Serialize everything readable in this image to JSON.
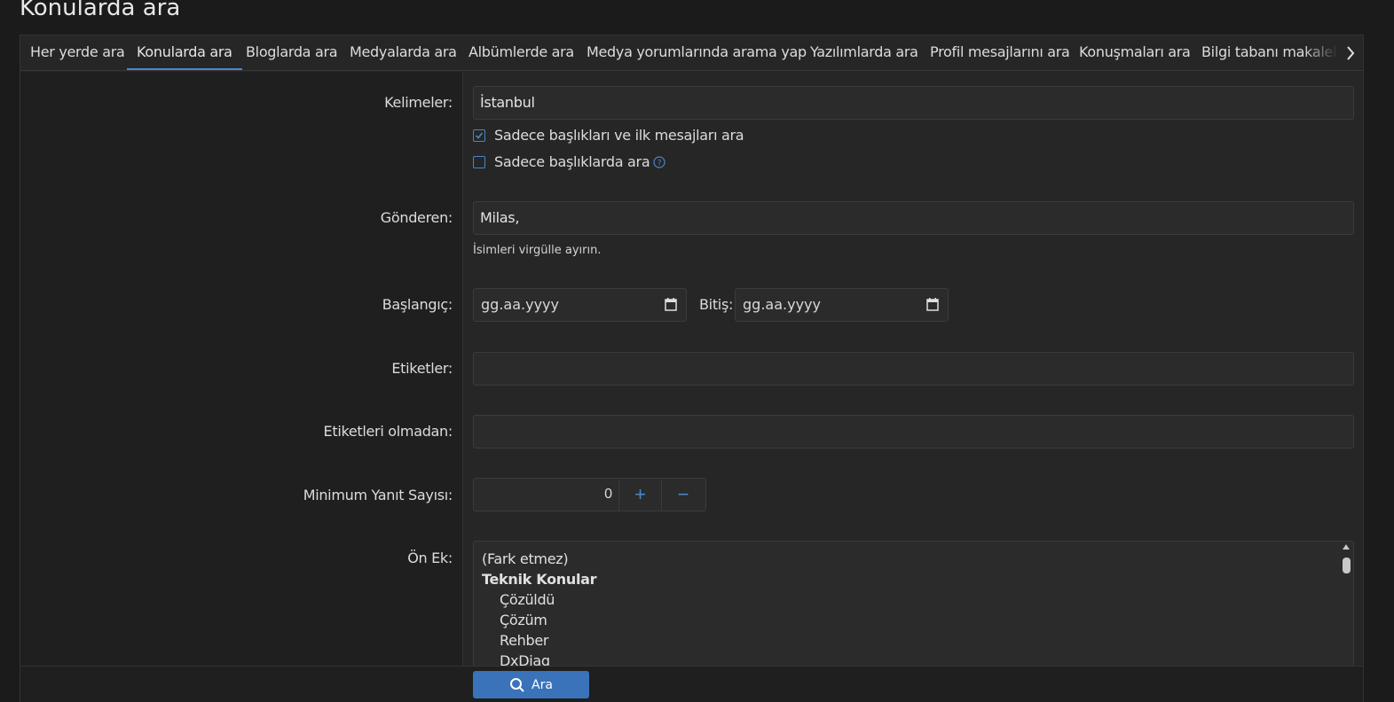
{
  "page": {
    "title": "Konularda ara"
  },
  "tabs": [
    {
      "label": "Her yerde ara"
    },
    {
      "label": "Konularda ara"
    },
    {
      "label": "Bloglarda ara"
    },
    {
      "label": "Medyalarda ara"
    },
    {
      "label": "Albümlerde ara"
    },
    {
      "label": "Medya yorumlarında arama yap"
    },
    {
      "label": "Yazılımlarda ara"
    },
    {
      "label": "Profil mesajlarını ara"
    },
    {
      "label": "Konuşmaları ara"
    },
    {
      "label": "Bilgi tabanı makaleleri"
    }
  ],
  "form": {
    "keywords": {
      "label": "Kelimeler:",
      "value": "İstanbul"
    },
    "title_first_checkbox": {
      "label": "Sadece başlıkları ve ilk mesajları ara",
      "checked": true
    },
    "title_only_checkbox": {
      "label": "Sadece başlıklarda ara",
      "checked": false
    },
    "posted_by": {
      "label": "Gönderen:",
      "value": "Milas,",
      "hint": "İsimleri virgülle ayırın."
    },
    "start_date": {
      "label": "Başlangıç:",
      "placeholder": "gg.aa.yyyy"
    },
    "end_date": {
      "label": "Bitiş:",
      "placeholder": "gg.aa.yyyy"
    },
    "tags": {
      "label": "Etiketler:",
      "value": ""
    },
    "without_tags": {
      "label": "Etiketleri olmadan:",
      "value": ""
    },
    "min_replies": {
      "label": "Minimum Yanıt Sayısı:",
      "value": "0",
      "plus": "+",
      "minus": "−"
    },
    "prefix": {
      "label": "Ön Ek:",
      "options": [
        {
          "text": "(Fark etmez)"
        },
        {
          "text": "Teknik Konular"
        },
        {
          "text": "Çözüldü"
        },
        {
          "text": "Çözüm"
        },
        {
          "text": "Rehber"
        },
        {
          "text": "DxDiag"
        }
      ]
    }
  },
  "footer": {
    "search_label": "Ara"
  },
  "colors": {
    "accent": "#4a86c9",
    "button": "#3a73b9",
    "background": "#1b1b1b",
    "panel": "#262626"
  }
}
